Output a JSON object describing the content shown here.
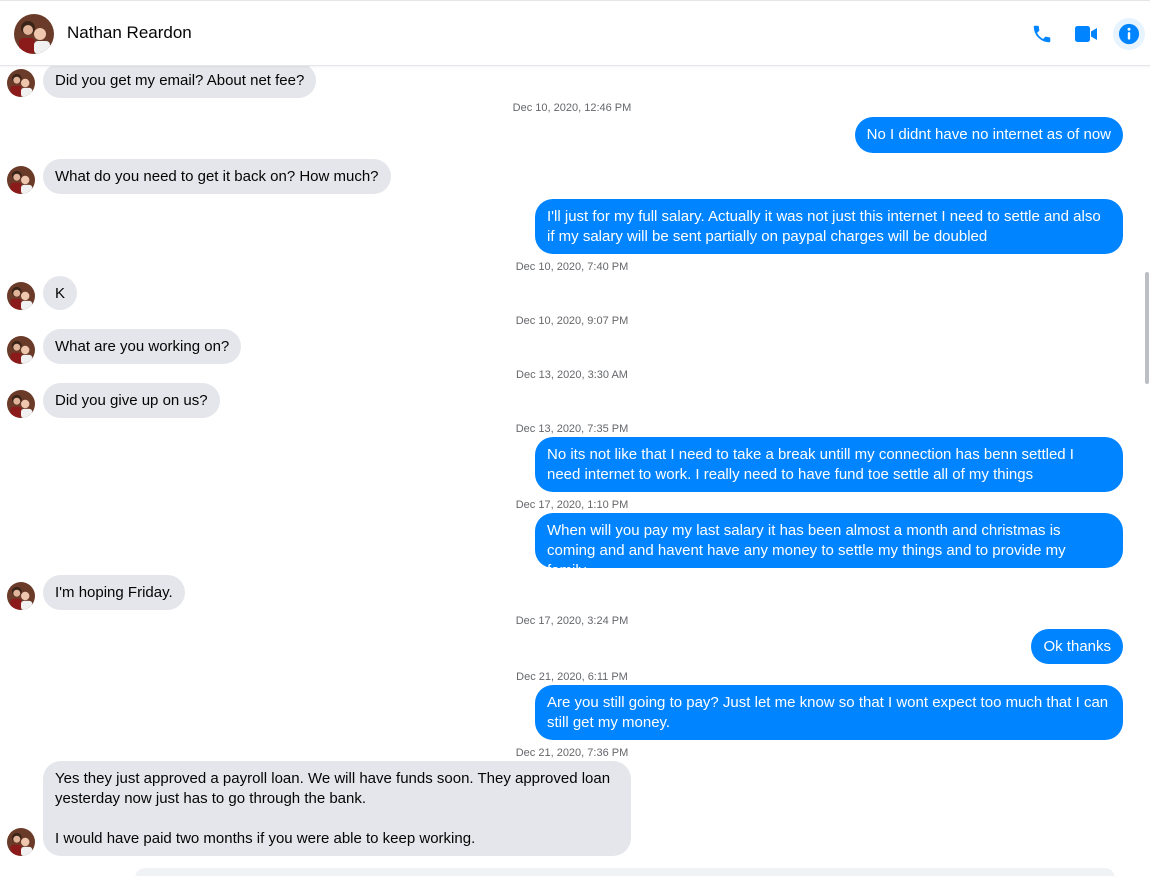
{
  "header": {
    "contact_name": "Nathan Reardon",
    "accent_color": "#0084ff"
  },
  "icons": {
    "call": "phone-icon",
    "video": "video-camera-icon",
    "info": "info-icon"
  },
  "messages": [
    {
      "type": "in",
      "text": "Did you get my email? About net fee?"
    },
    {
      "type": "ts",
      "text": "Dec 10, 2020, 12:46 PM"
    },
    {
      "type": "out",
      "text": "No I didnt have no internet as of now"
    },
    {
      "type": "in",
      "text": "What do you need to get it back on? How much?"
    },
    {
      "type": "out",
      "text": "I'll just for my full salary. Actually it was not just this internet I need to settle and also if my salary will be sent partially on paypal charges will be doubled"
    },
    {
      "type": "ts",
      "text": "Dec 10, 2020, 7:40 PM"
    },
    {
      "type": "in",
      "text": "K"
    },
    {
      "type": "ts",
      "text": "Dec 10, 2020, 9:07 PM"
    },
    {
      "type": "in",
      "text": "What are you working on?"
    },
    {
      "type": "ts",
      "text": "Dec 13, 2020, 3:30 AM"
    },
    {
      "type": "in",
      "text": "Did you give up on us?"
    },
    {
      "type": "ts",
      "text": "Dec 13, 2020, 7:35 PM"
    },
    {
      "type": "out",
      "text": "No its not like that I need to take a break untill my connection has benn settled I need internet to work. I really need to have fund toe settle all of my things"
    },
    {
      "type": "ts",
      "text": "Dec 17, 2020, 1:10 PM"
    },
    {
      "type": "out",
      "text": "When will you pay my last salary it has been almost a month and christmas is coming and and havent have any money to settle my things and to provide my family."
    },
    {
      "type": "in",
      "text": "I'm hoping Friday."
    },
    {
      "type": "ts",
      "text": "Dec 17, 2020, 3:24 PM"
    },
    {
      "type": "out",
      "text": "Ok thanks"
    },
    {
      "type": "ts",
      "text": "Dec 21, 2020, 6:11 PM"
    },
    {
      "type": "out",
      "text": "Are you still going to pay? Just let me know so that I wont expect too much that I can still get my money."
    },
    {
      "type": "ts",
      "text": "Dec 21, 2020, 7:36 PM"
    },
    {
      "type": "in",
      "text": "Yes they just approved a payroll loan. We will have funds soon. They approved loan yesterday now just has to go through the bank.\n\nI would have paid two months if you were able to keep working."
    }
  ]
}
